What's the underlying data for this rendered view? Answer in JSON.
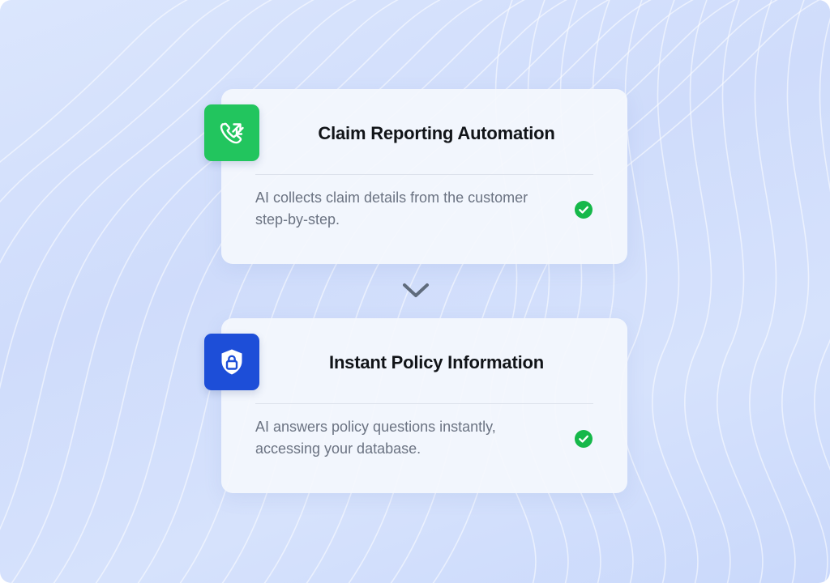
{
  "colors": {
    "claim_badge": "#22c55e",
    "policy_badge": "#1d4ed8",
    "check": "#16b84a",
    "chevron": "#5f6b7c"
  },
  "steps": [
    {
      "icon": "phone-transfer-icon",
      "title": "Claim Reporting Automation",
      "description": "AI collects claim details from the customer step-by-step.",
      "status_icon": "check-circle-icon"
    },
    {
      "icon": "shield-lock-icon",
      "title": "Instant Policy Information",
      "description": "AI answers policy questions instantly, accessing your database.",
      "status_icon": "check-circle-icon"
    }
  ],
  "connector_icon": "chevron-down-icon"
}
